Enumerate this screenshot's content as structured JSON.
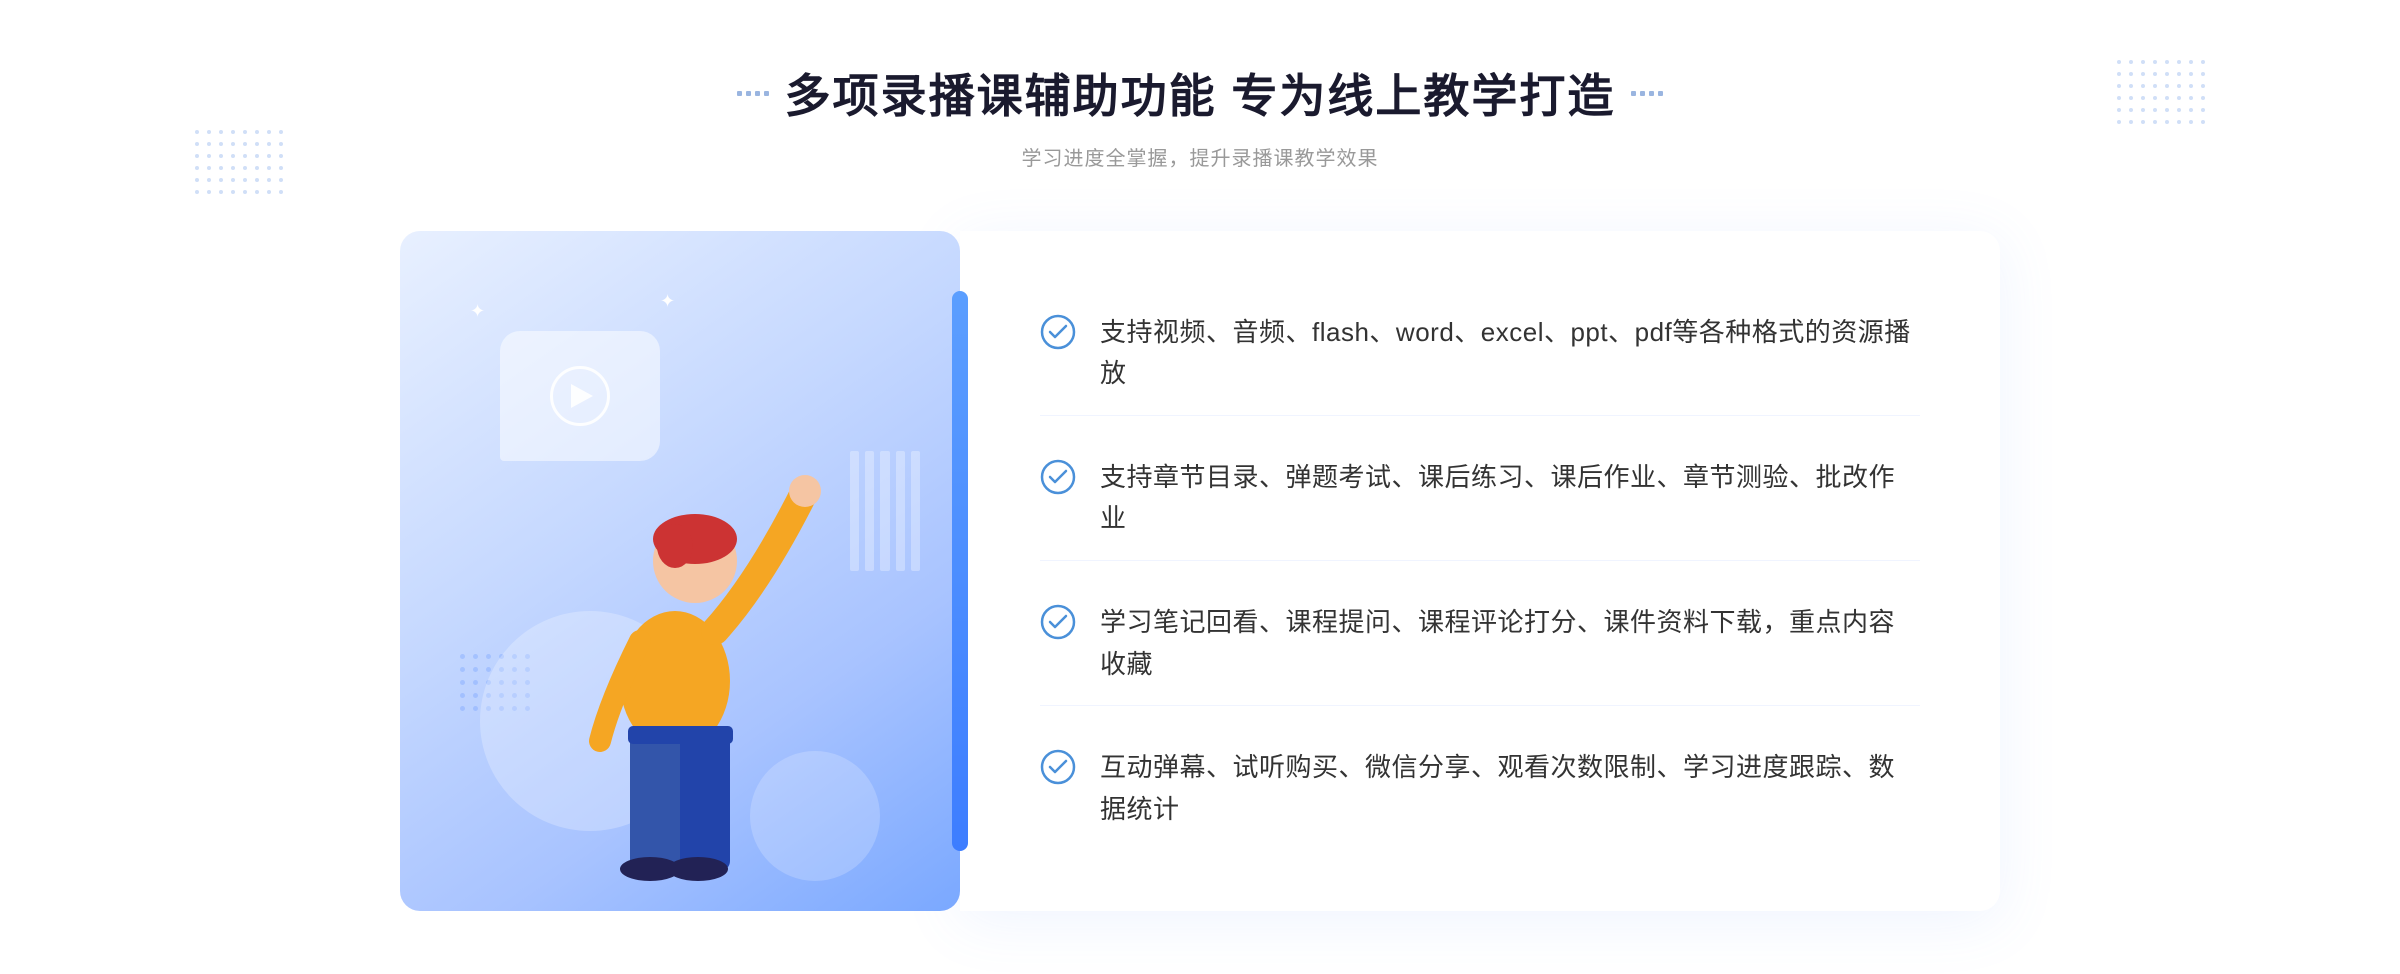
{
  "page": {
    "title": "多项录播课辅助功能 专为线上教学打造",
    "subtitle": "学习进度全掌握，提升录播课教学效果",
    "features": [
      {
        "id": "feature-1",
        "text": "支持视频、音频、flash、word、excel、ppt、pdf等各种格式的资源播放"
      },
      {
        "id": "feature-2",
        "text": "支持章节目录、弹题考试、课后练习、课后作业、章节测验、批改作业"
      },
      {
        "id": "feature-3",
        "text": "学习笔记回看、课程提问、课程评论打分、课件资料下载，重点内容收藏"
      },
      {
        "id": "feature-4",
        "text": "互动弹幕、试听购买、微信分享、观看次数限制、学习进度跟踪、数据统计"
      }
    ],
    "colors": {
      "primary": "#3d7dff",
      "secondary": "#5b9eff",
      "title": "#1a1a2e",
      "subtitle": "#999999",
      "feature_text": "#333333",
      "check_color": "#4a90d9"
    },
    "decorators": {
      "left_chevron": "»",
      "sparkle": "✦"
    }
  }
}
